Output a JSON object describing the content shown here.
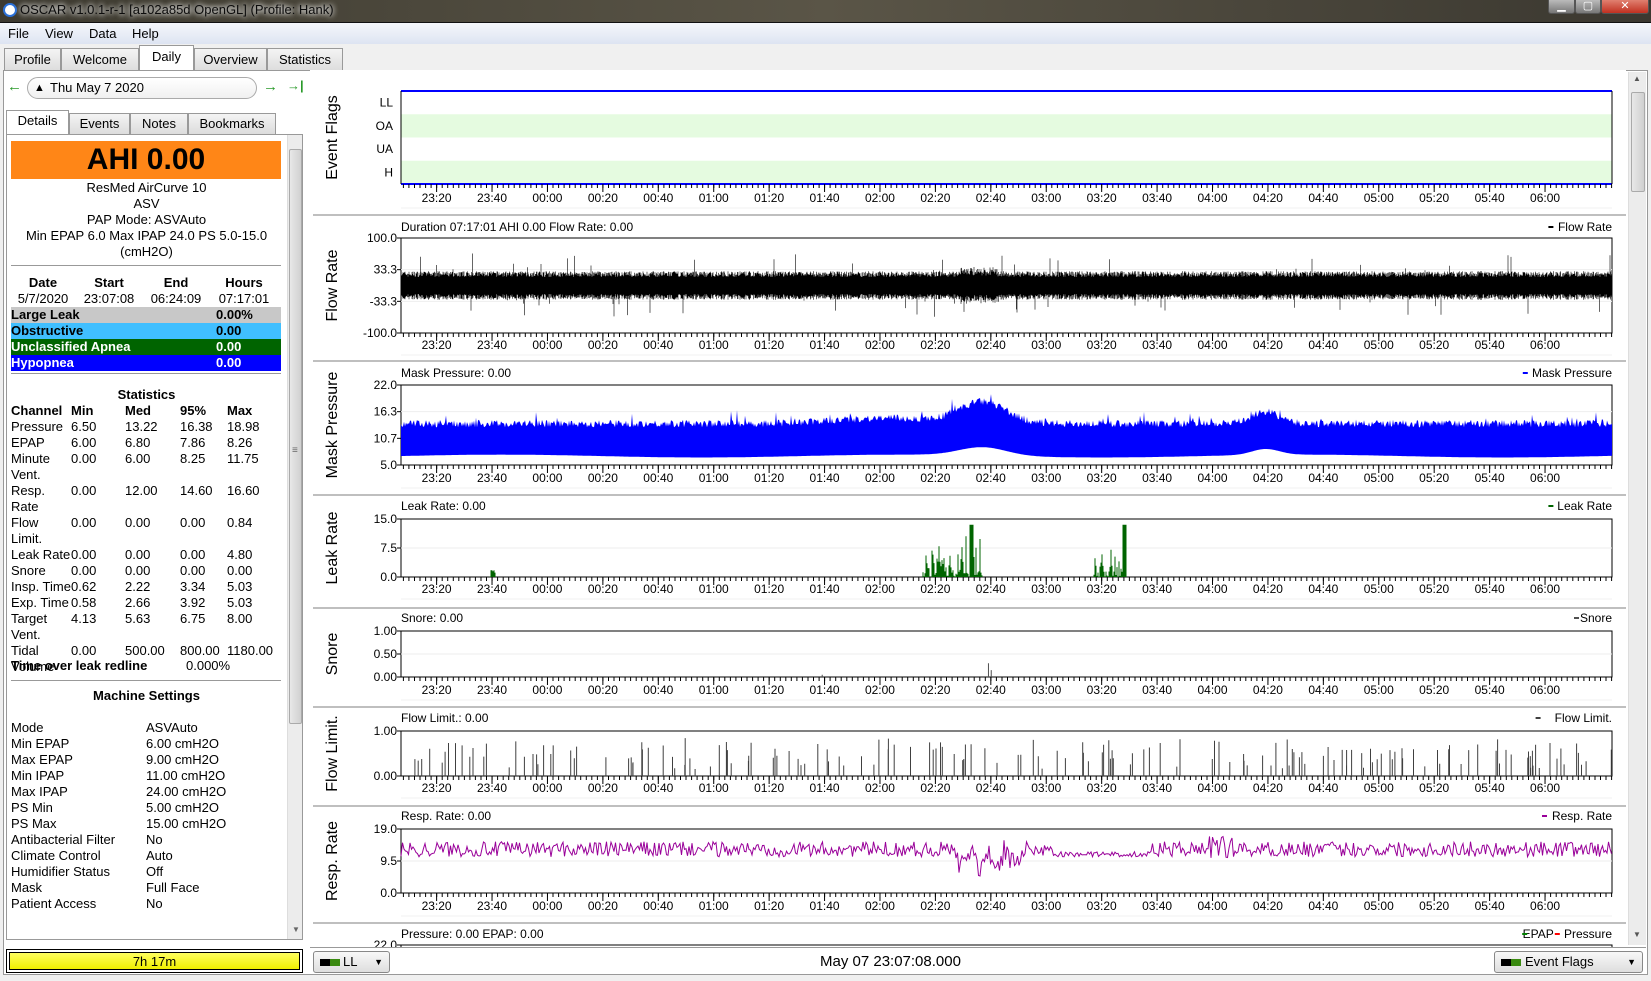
{
  "window": {
    "title": "OSCAR v1.0.1-r-1 [a102a85d OpenGL] (Profile: Hank)",
    "min": "▁",
    "max": "▢",
    "close": "✕"
  },
  "menu": [
    "File",
    "View",
    "Data",
    "Help"
  ],
  "tabs": [
    {
      "label": "Profile"
    },
    {
      "label": "Welcome"
    },
    {
      "label": "Daily",
      "active": true
    },
    {
      "label": "Overview"
    },
    {
      "label": "Statistics"
    }
  ],
  "nav": {
    "back_icon": "←",
    "date": "Thu May 7 2020",
    "forward_icon": "→",
    "last_icon": "→|"
  },
  "subtabs": [
    {
      "label": "Details",
      "active": true
    },
    {
      "label": "Events"
    },
    {
      "label": "Notes"
    },
    {
      "label": "Bookmarks"
    }
  ],
  "details": {
    "ahi": "AHI 0.00",
    "ahi_color": "#ff8617",
    "machine": "ResMed AirCurve 10",
    "model": "ASV",
    "pap_mode": "PAP Mode: ASVAuto",
    "pressure_line": "Min EPAP 6.0 Max IPAP 24.0 PS 5.0-15.0",
    "units": "(cmH2O)",
    "session_headers": [
      "Date",
      "Start",
      "End",
      "Hours"
    ],
    "session_values": [
      "5/7/2020",
      "23:07:08",
      "06:24:09",
      "07:17:01"
    ],
    "events": [
      {
        "name": "Large Leak",
        "value": "0.00%",
        "bg": "#c8c8c8",
        "fg": "#000000"
      },
      {
        "name": "Obstructive",
        "value": "0.00",
        "bg": "#40bfff",
        "fg": "#000000"
      },
      {
        "name": "Unclassified Apnea",
        "value": "0.00",
        "bg": "#006400",
        "fg": "#ffffff"
      },
      {
        "name": "Hypopnea",
        "value": "0.00",
        "bg": "#0000ff",
        "fg": "#ffffff"
      }
    ],
    "statistics_title": "Statistics",
    "stats_headers": [
      "Channel",
      "Min",
      "Med",
      "95%",
      "Max"
    ],
    "stats": [
      [
        "Pressure",
        "6.50",
        "13.22",
        "16.38",
        "18.98"
      ],
      [
        "EPAP",
        "6.00",
        "6.80",
        "7.86",
        "8.26"
      ],
      [
        "Minute Vent.",
        "0.00",
        "6.00",
        "8.25",
        "11.75"
      ],
      [
        "Resp. Rate",
        "0.00",
        "12.00",
        "14.60",
        "16.60"
      ],
      [
        "Flow Limit.",
        "0.00",
        "0.00",
        "0.00",
        "0.84"
      ],
      [
        "Leak Rate",
        "0.00",
        "0.00",
        "0.00",
        "4.80"
      ],
      [
        "Snore",
        "0.00",
        "0.00",
        "0.00",
        "0.00"
      ],
      [
        "Insp. Time",
        "0.62",
        "2.22",
        "3.34",
        "5.03"
      ],
      [
        "Exp. Time",
        "0.58",
        "2.66",
        "3.92",
        "5.03"
      ],
      [
        "Target Vent.",
        "4.13",
        "5.63",
        "6.75",
        "8.00"
      ],
      [
        "Tidal Volume",
        "0.00",
        "500.00",
        "800.00",
        "1180.00"
      ]
    ],
    "leak_redline_label": "Time over leak redline",
    "leak_redline_value": "0.000%",
    "machine_settings_title": "Machine Settings",
    "settings": [
      [
        "Mode",
        "ASVAuto"
      ],
      [
        "Min EPAP",
        "6.00 cmH2O"
      ],
      [
        "Max EPAP",
        "9.00 cmH2O"
      ],
      [
        "Min IPAP",
        "11.00 cmH2O"
      ],
      [
        "Max IPAP",
        "24.00 cmH2O"
      ],
      [
        "PS Min",
        "5.00 cmH2O"
      ],
      [
        "PS Max",
        "15.00 cmH2O"
      ],
      [
        "Antibacterial Filter",
        "No"
      ],
      [
        "Climate Control",
        "Auto"
      ],
      [
        "Humidifier Status",
        "Off"
      ],
      [
        "Mask",
        "Full Face"
      ],
      [
        "Patient Access",
        "No"
      ]
    ],
    "duration_bar": "7h 17m"
  },
  "time_axis": {
    "start": "23:07:08",
    "end": "06:24:09",
    "labels": [
      "23:20",
      "23:40",
      "00:00",
      "00:20",
      "00:40",
      "01:00",
      "01:20",
      "01:40",
      "02:00",
      "02:20",
      "02:40",
      "03:00",
      "03:20",
      "03:40",
      "04:00",
      "04:20",
      "04:40",
      "05:00",
      "05:20",
      "05:40",
      "06:00"
    ]
  },
  "chart_data": [
    {
      "id": "flags",
      "type": "table",
      "ylabel": "Event Flags",
      "rows": [
        "LL",
        "OA",
        "UA",
        "H"
      ],
      "band_color": "#e5fbe0",
      "border_color": "#0000ff"
    },
    {
      "id": "flow",
      "type": "line",
      "ylabel": "Flow Rate",
      "title": "Duration 07:17:01 AHI 0.00 Flow Rate: 0.00",
      "legend": [
        {
          "name": "Flow Rate",
          "color": "#000000"
        }
      ],
      "ylim": [
        -100,
        100
      ],
      "yticks": [
        "100.0",
        "33.3",
        "-33.3",
        "-100.0"
      ],
      "color": "#000000"
    },
    {
      "id": "mask",
      "type": "area",
      "ylabel": "Mask Pressure",
      "title": "Mask Pressure: 0.00",
      "legend": [
        {
          "name": "Mask Pressure",
          "color": "#0000ff"
        }
      ],
      "ylim": [
        5,
        22
      ],
      "yticks": [
        "22.0",
        "16.3",
        "10.7",
        "5.0"
      ],
      "color": "#0000ff"
    },
    {
      "id": "leak",
      "type": "line",
      "ylabel": "Leak Rate",
      "title": "Leak Rate: 0.00",
      "legend": [
        {
          "name": "Leak Rate",
          "color": "#006400"
        }
      ],
      "ylim": [
        0,
        15
      ],
      "yticks": [
        "15.0",
        "7.5",
        "0.0"
      ],
      "color": "#006400"
    },
    {
      "id": "snore",
      "type": "line",
      "ylabel": "Snore",
      "title": "Snore: 0.00",
      "legend": [
        {
          "name": "Snore",
          "color": "#505050"
        }
      ],
      "ylim": [
        0,
        1
      ],
      "yticks": [
        "1.00",
        "0.50",
        "0.00"
      ],
      "color": "#505050"
    },
    {
      "id": "flowlim",
      "type": "bar",
      "ylabel": "Flow Limit.",
      "title": "Flow Limit.: 0.00",
      "legend": [
        {
          "name": "Flow Limit.",
          "color": "#404040"
        }
      ],
      "ylim": [
        0,
        1
      ],
      "yticks": [
        "1.00",
        "0.00"
      ],
      "color": "#404040"
    },
    {
      "id": "resp",
      "type": "line",
      "ylabel": "Resp. Rate",
      "title": "Resp. Rate: 0.00",
      "legend": [
        {
          "name": "Resp. Rate",
          "color": "#990099"
        }
      ],
      "ylim": [
        0,
        19
      ],
      "yticks": [
        "19.0",
        "9.5",
        "0.0"
      ],
      "color": "#990099"
    },
    {
      "id": "pressure",
      "type": "line",
      "ylabel": "",
      "title": "Pressure: 0.00 EPAP: 0.00",
      "legend": [
        {
          "name": "EPAP",
          "color": "#008000"
        },
        {
          "name": "Pressure",
          "color": "#ff0000"
        }
      ],
      "yticks": [
        "22.0"
      ]
    }
  ],
  "bottom": {
    "left_dropdown": "LL",
    "cursor_time": "May 07 23:07:08.000",
    "right_dropdown": "Event Flags"
  }
}
